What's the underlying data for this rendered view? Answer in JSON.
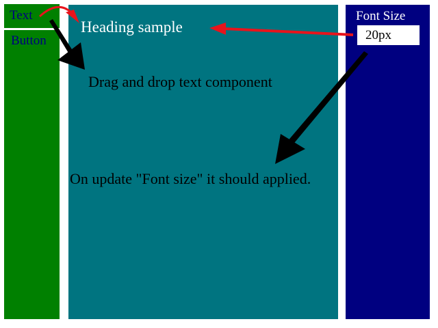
{
  "colors": {
    "left_panel": "#008000",
    "canvas": "#007480",
    "right_panel": "#000080",
    "nav_text": "#000080",
    "heading_text": "#ffffff",
    "body_text": "#000000",
    "label_text": "#ffffff",
    "arrow_red": "#e8141c",
    "arrow_black": "#000000"
  },
  "components": {
    "text_label": "Text",
    "button_label": "Button"
  },
  "canvas": {
    "heading": "Heading sample",
    "drag_drop": "Drag and drop text component",
    "update_note": "On update \"Font size\" it should applied."
  },
  "properties": {
    "font_size_label": "Font Size",
    "font_size_value": "20px"
  },
  "annotations": {
    "arrow_text_to_canvas": "curved-arrow",
    "arrow_input_to_heading": "arrow",
    "arrow_text_drag": "arrow",
    "arrow_input_to_note": "arrow"
  }
}
